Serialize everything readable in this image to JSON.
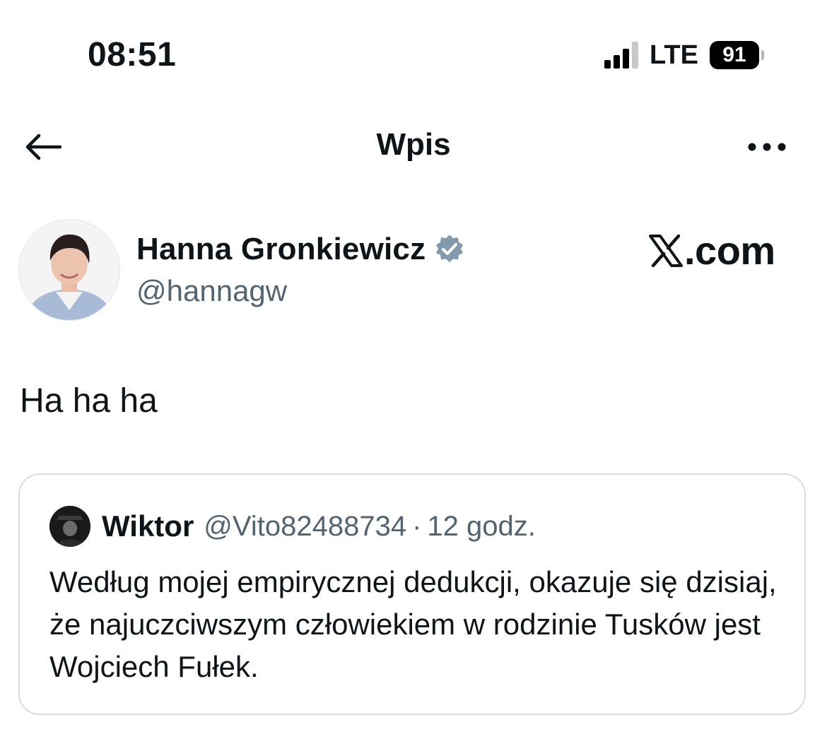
{
  "status_bar": {
    "time": "08:51",
    "network": "LTE",
    "battery": "91",
    "signal_bars_active": 3,
    "signal_bars_total": 4
  },
  "header": {
    "title": "Wpis",
    "back_icon": "arrow-left-icon",
    "more_icon": "more-horizontal-icon"
  },
  "post": {
    "author_name": "Hanna Gronkiewicz",
    "author_handle": "@hannagw",
    "verified_color": "#829aab",
    "brand": ".com",
    "brand_icon": "x-logo-icon",
    "text": "Ha ha ha"
  },
  "quote": {
    "author_name": "Wiktor",
    "author_handle": "@Vito82488734",
    "separator": "·",
    "time": "12 godz.",
    "text": "Według mojej empirycznej dedukcji, okazuje się dzisiaj, że najuczciwszym człowiekiem w rodzinie Tusków jest Wojciech Fułek."
  },
  "colors": {
    "text": "#0f1419",
    "secondary_text": "#536471",
    "border": "#d8dde2"
  }
}
